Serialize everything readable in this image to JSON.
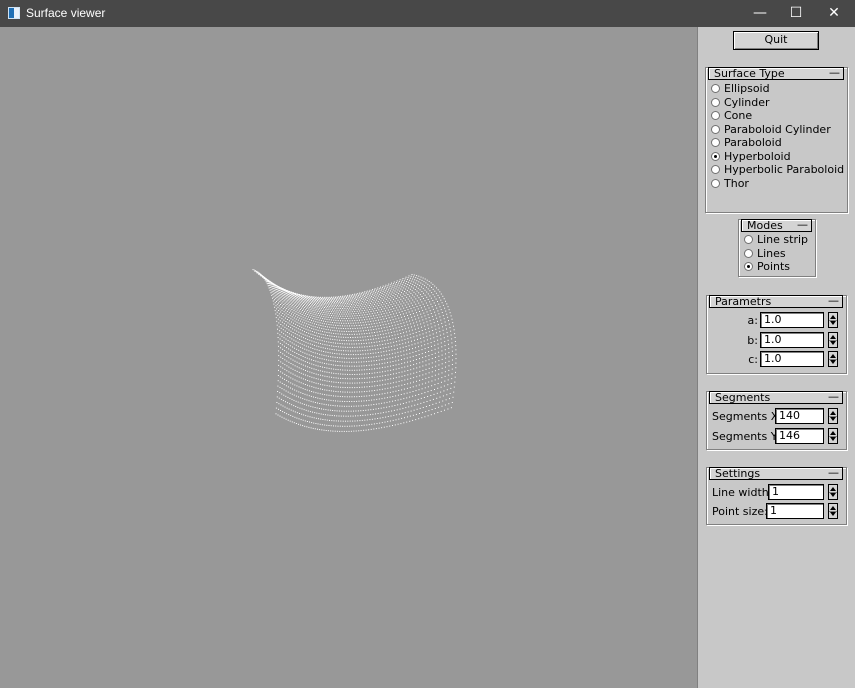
{
  "window": {
    "title": "Surface viewer",
    "controls": {
      "minimize": "—",
      "maximize": "☐",
      "close": "✕"
    }
  },
  "quit_label": "Quit",
  "surface_type": {
    "title": "Surface Type",
    "collapse": "—",
    "options": [
      "Ellipsoid",
      "Cylinder",
      "Cone",
      "Paraboloid Cylinder",
      "Paraboloid",
      "Hyperboloid",
      "Hyperbolic Paraboloid",
      "Thor"
    ],
    "selected": "Hyperboloid"
  },
  "modes": {
    "title": "Modes",
    "collapse": "—",
    "options": [
      "Line strip",
      "Lines",
      "Points"
    ],
    "selected": "Points"
  },
  "parameters": {
    "title": "Parametrs",
    "collapse": "—",
    "a_label": "a:",
    "a_value": "1.0",
    "b_label": "b:",
    "b_value": "1.0",
    "c_label": "c:",
    "c_value": "1.0"
  },
  "segments": {
    "title": "Segments",
    "collapse": "—",
    "x_label": "Segments X:",
    "x_value": "140",
    "y_label": "Segments Y:",
    "y_value": "146"
  },
  "settings": {
    "title": "Settings",
    "collapse": "—",
    "line_width_label": "Line width:",
    "line_width_value": "1",
    "point_size_label": "Point size:",
    "point_size_value": "1"
  },
  "colors": {
    "viewport_bg": "#989898",
    "points": "#ffffff",
    "panel_bg": "#c8c8c8",
    "titlebar_bg": "#484848"
  }
}
